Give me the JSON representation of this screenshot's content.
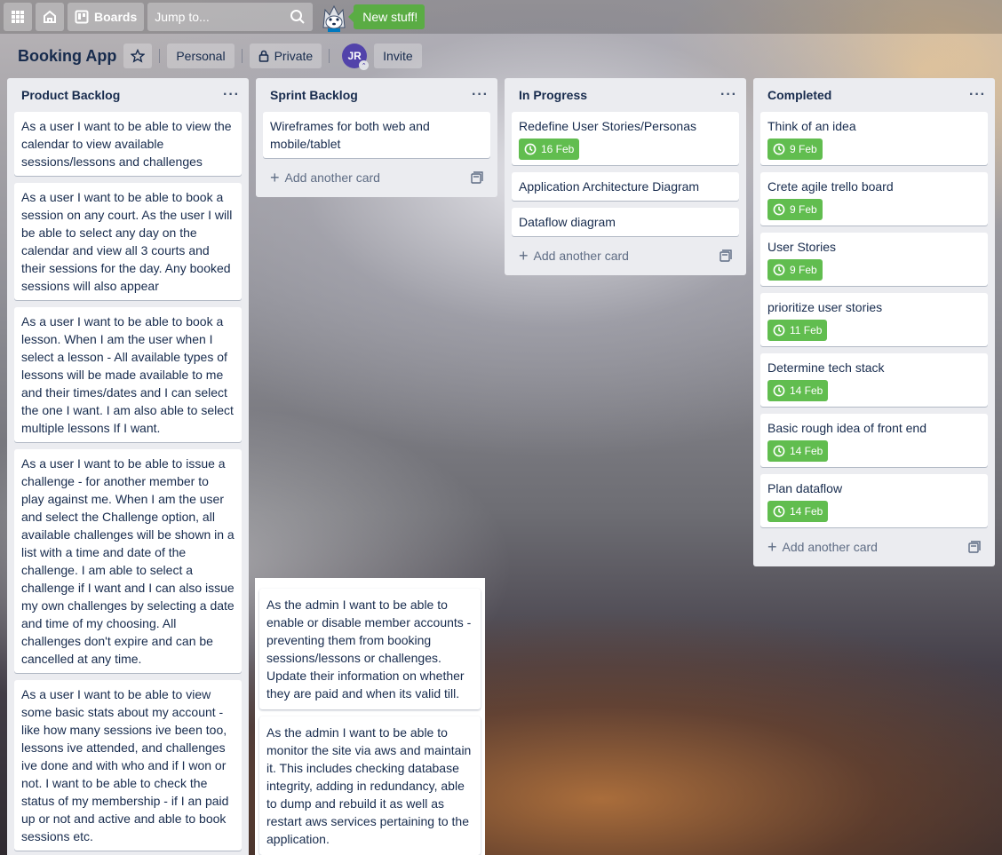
{
  "header": {
    "boards_label": "Boards",
    "search_placeholder": "Jump to...",
    "new_stuff_label": "New stuff!"
  },
  "board": {
    "title": "Booking App",
    "team_label": "Personal",
    "visibility_label": "Private",
    "member_initials": "JR",
    "invite_label": "Invite"
  },
  "lists": [
    {
      "title": "Product Backlog",
      "cards": [
        {
          "text": "As a user I want to be able to view the calendar to view available sessions/lessons and challenges"
        },
        {
          "text": "As a user I want to be able to book a session on any court. As the user I will be able to select any day on the calendar and view all 3 courts and their sessions for the day. Any booked sessions will also appear"
        },
        {
          "text": "As a user I want to be able to book a lesson. When I am the user when I select a lesson - All available types of lessons will be made available to me and their times/dates and I can select the one I want. I am also able to select multiple lessons If I want."
        },
        {
          "text": "As a user I want to be able to issue a challenge - for another member to play against me. When I am the user and select the Challenge option, all available challenges will be shown in a list with a time and date of the challenge. I am able to select a challenge if I want and I can also issue my own challenges by selecting a date and time of my choosing. All challenges don't expire and can be cancelled at any time."
        },
        {
          "text": "As a user I want to be able to view some basic stats about my account - like how many sessions ive been too, lessons ive attended, and challenges ive done and with who and if I won or not. I want to be able to check the status of my membership - if I an paid up or not and active and able to book sessions etc."
        }
      ]
    },
    {
      "title": "Sprint Backlog",
      "cards": [
        {
          "text": "Wireframes for both web and mobile/tablet"
        }
      ],
      "add_label": "Add another card"
    },
    {
      "title": "In Progress",
      "cards": [
        {
          "text": "Redefine User Stories/Personas",
          "due": "16 Feb"
        },
        {
          "text": "Application Architecture Diagram"
        },
        {
          "text": "Dataflow diagram"
        }
      ],
      "add_label": "Add another card"
    },
    {
      "title": "Completed",
      "cards": [
        {
          "text": "Think of an idea",
          "due": "9 Feb"
        },
        {
          "text": "Crete agile trello board",
          "due": "9 Feb"
        },
        {
          "text": "User Stories",
          "due": "9 Feb"
        },
        {
          "text": "prioritize user stories",
          "due": "11 Feb"
        },
        {
          "text": "Determine tech stack",
          "due": "14 Feb"
        },
        {
          "text": "Basic rough idea of front end",
          "due": "14 Feb"
        },
        {
          "text": "Plan dataflow",
          "due": "14 Feb"
        }
      ],
      "add_label": "Add another card"
    }
  ],
  "floating_cards": [
    {
      "text": "As the admin I want to be able to enable or disable member accounts - preventing them from booking sessions/lessons or challenges. Update their information on whether they are paid and when its valid till."
    },
    {
      "text": "As the admin I want to be able to monitor the site via aws and maintain it. This includes checking database integrity, adding in redundancy, able to dump and rebuild it as well as restart aws services pertaining to the application."
    }
  ],
  "colors": {
    "list_bg": "#ebecf0",
    "due_badge": "#61bd4f",
    "new_stuff": "#5aac44",
    "avatar": "#5243aa"
  }
}
